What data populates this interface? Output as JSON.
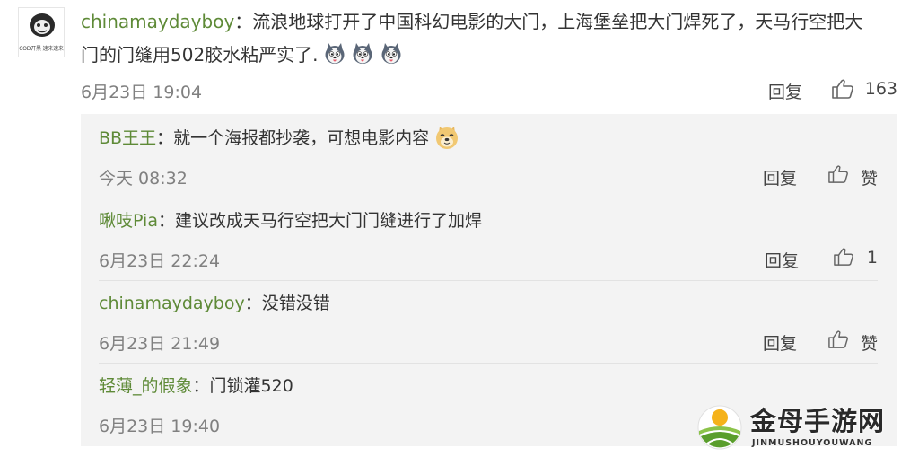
{
  "comment": {
    "avatar_caption": "COD开黑 速来速来",
    "username": "chinamaydayboy",
    "separator": "：",
    "text_line1": "流浪地球打开了中国科幻电影的大门，上海堡垒把大门焊死了，天马行空把大",
    "text_line2": "门的门缝用502胶水粘严实了.",
    "emoji": "husky-emoji",
    "time": "6月23日 19:04",
    "reply_label": "回复",
    "like_count": "163"
  },
  "replies": [
    {
      "username": "BB王王",
      "separator": "：",
      "text": "就一个海报都抄袭，可想电影内容",
      "emoji": "doge-emoji",
      "time": "今天 08:32",
      "reply_label": "回复",
      "like_label": "赞"
    },
    {
      "username": "啾吱Pia",
      "separator": "：",
      "text": "建议改成天马行空把大门门缝进行了加焊",
      "time": "6月23日 22:24",
      "reply_label": "回复",
      "like_label": "1"
    },
    {
      "username": "chinamaydayboy",
      "separator": "：",
      "text": "没错没错",
      "time": "6月23日 21:49",
      "reply_label": "回复",
      "like_label": "赞"
    },
    {
      "username": "轻薄_的假象",
      "separator": "：",
      "text": "门锁灌520",
      "time": "6月23日 19:40"
    }
  ],
  "watermark": {
    "title": "金母手游网",
    "subtitle": "JINMUSHOUYOUWANG"
  },
  "colors": {
    "username": "#5e8a37",
    "reply_bg": "#f3f3f3",
    "meta": "#808080"
  }
}
